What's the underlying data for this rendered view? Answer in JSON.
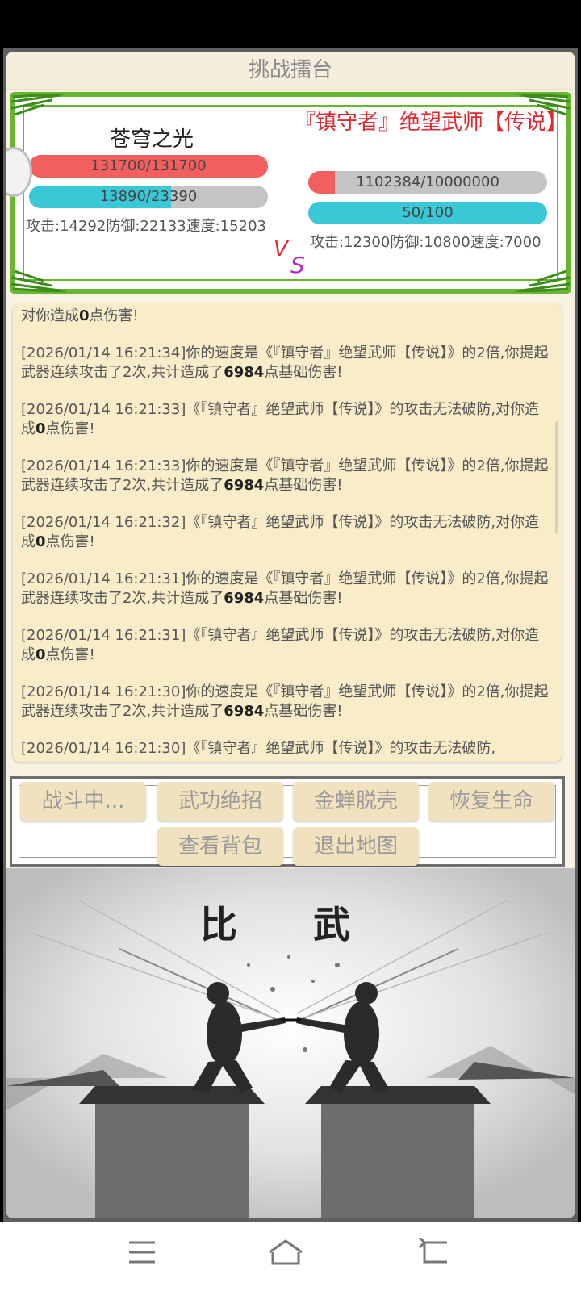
{
  "header": {
    "title": "挑战擂台"
  },
  "player": {
    "name": "苍穹之光",
    "hp_text": "131700/131700",
    "hp_fraction": 1.0,
    "mp_text": "13890/23390",
    "mp_fraction": 0.594,
    "stats": "攻击:14292防御:22133速度:15203"
  },
  "enemy": {
    "name": "『镇守者』绝望武师【传说】",
    "hp_text": "1102384/10000000",
    "hp_fraction": 0.11,
    "mp_text": "50/100",
    "mp_fraction": 1.0,
    "stats": "攻击:12300防御:10800速度:7000"
  },
  "vs": {
    "v": "V",
    "s": "S"
  },
  "log": {
    "top_fragment": {
      "before": "对你造成",
      "bold": "0",
      "after": "点伤害!"
    },
    "entries": [
      {
        "before": "[2026/01/14 16:21:34]你的速度是《『镇守者』绝望武师【传说】》的2倍,你提起武器连续攻击了2次,共计造成了",
        "bold": "6984",
        "after": "点基础伤害!"
      },
      {
        "before": "[2026/01/14 16:21:33]《『镇守者』绝望武师【传说】》的攻击无法破防,对你造成",
        "bold": "0",
        "after": "点伤害!"
      },
      {
        "before": "[2026/01/14 16:21:33]你的速度是《『镇守者』绝望武师【传说】》的2倍,你提起武器连续攻击了2次,共计造成了",
        "bold": "6984",
        "after": "点基础伤害!"
      },
      {
        "before": "[2026/01/14 16:21:32]《『镇守者』绝望武师【传说】》的攻击无法破防,对你造成",
        "bold": "0",
        "after": "点伤害!"
      },
      {
        "before": "[2026/01/14 16:21:31]你的速度是《『镇守者』绝望武师【传说】》的2倍,你提起武器连续攻击了2次,共计造成了",
        "bold": "6984",
        "after": "点基础伤害!"
      },
      {
        "before": "[2026/01/14 16:21:31]《『镇守者』绝望武师【传说】》的攻击无法破防,对你造成",
        "bold": "0",
        "after": "点伤害!"
      },
      {
        "before": "[2026/01/14 16:21:30]你的速度是《『镇守者』绝望武师【传说】》的2倍,你提起武器连续攻击了2次,共计造成了",
        "bold": "6984",
        "after": "点基础伤害!"
      },
      {
        "before": "[2026/01/14 16:21:30]《『镇守者』绝望武师【传说】》的攻击无法破防,",
        "bold": "",
        "after": ""
      }
    ]
  },
  "actions": {
    "fighting": "战斗中...",
    "skill": "武功绝招",
    "escape": "金蝉脱壳",
    "heal": "恢复生命",
    "bag": "查看背包",
    "exit": "退出地图"
  },
  "scene": {
    "title_left": "比",
    "title_right": "武"
  },
  "colors": {
    "hp": "#f25f5f",
    "mp": "#3bc8d6",
    "bar_bg": "#c6c3c3",
    "frame_green": "#68b52f",
    "enemy_name": "#e0282f"
  }
}
